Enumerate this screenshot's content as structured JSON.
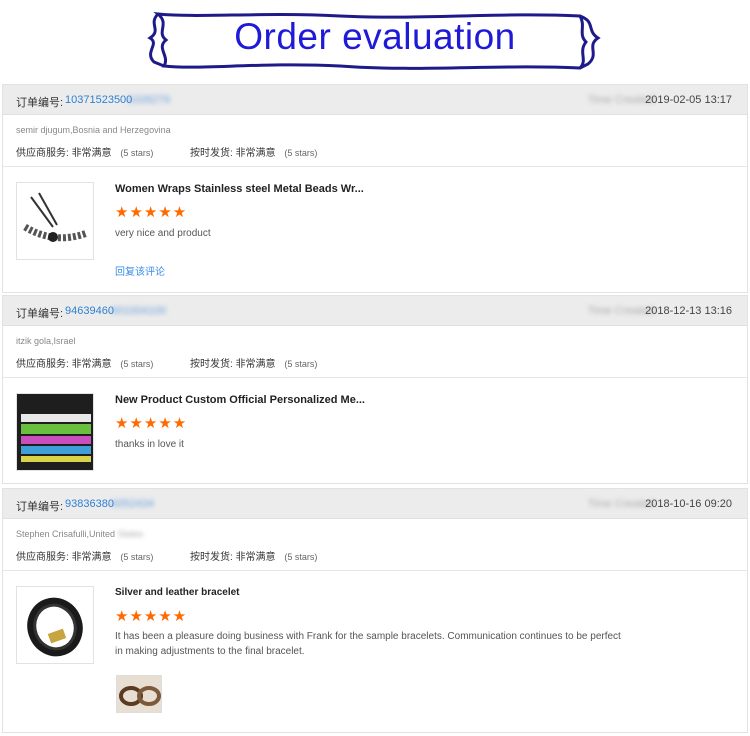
{
  "banner": {
    "title": "Order evaluation"
  },
  "labels": {
    "order_no": "订单编号:",
    "supplier_service": "供应商服务:",
    "shipping": "按时发货:",
    "very_satisfied": "非常满意",
    "five_stars": "(5 stars)",
    "stars": "★★★★★",
    "reply": "回复该评论",
    "time_created": "Time Created:"
  },
  "orders": [
    {
      "order_no": "10371523500",
      "order_no_hidden": "1028279",
      "date": "2019-02-05 13:17",
      "buyer": "semir djugum,Bosnia and Herzegovina",
      "product_title": "Women Wraps Stainless steel Metal Beads Wr...",
      "comment": "very nice and product",
      "has_reply": true
    },
    {
      "order_no": "94639460",
      "order_no_hidden": "001004100",
      "date": "2018-12-13 13:16",
      "buyer": "itzik gola,Israel",
      "product_title": "New Product Custom Official Personalized Me...",
      "comment": "thanks in love it",
      "has_reply": false
    },
    {
      "order_no": "93836380",
      "order_no_hidden": "0052434",
      "date": "2018-10-16 09:20",
      "buyer": "Stephen Crisafulli,United",
      "buyer_hidden": "States",
      "product_title": "Silver and leather bracelet",
      "comment": "It has been a pleasure doing business with Frank for the sample bracelets. Communication continues to be perfect in making adjustments to the final bracelet.",
      "has_reply": false
    }
  ]
}
